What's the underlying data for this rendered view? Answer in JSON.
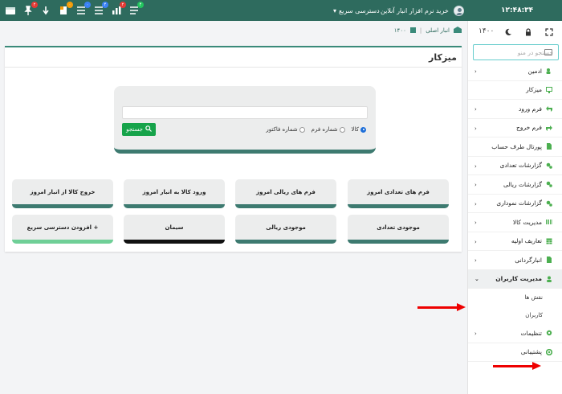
{
  "topbar": {
    "clock": "۱۲:۴۸:۳۴",
    "buy_link": "خرید نرم افزار انبار آنلاین",
    "quick_access": "دسترسی سریع",
    "quick_access_caret": "▾",
    "toolbar_icons": [
      {
        "name": "box-icon",
        "badge": "",
        "badge_color": ""
      },
      {
        "name": "pin-icon",
        "badge": "۲",
        "badge_color": "#e53935"
      },
      {
        "name": "arrow-down-icon",
        "badge": "",
        "badge_color": ""
      },
      {
        "name": "document-icon",
        "badge": "۰",
        "badge_color": "#f59e0b"
      },
      {
        "name": "list-icon",
        "badge": "۰",
        "badge_color": "#3b82f6"
      },
      {
        "name": "list-icon",
        "badge": "۴",
        "badge_color": "#3b82f6"
      },
      {
        "name": "chart-icon",
        "badge": "۲",
        "badge_color": "#e53935"
      },
      {
        "name": "list-icon",
        "badge": "۴",
        "badge_color": "#22c55e"
      }
    ]
  },
  "sidebar": {
    "year": "۱۴۰۰",
    "search_placeholder": "جستجو در منو",
    "items": [
      {
        "label": "ادمین",
        "icon": "users-gear-icon",
        "chevron": true
      },
      {
        "label": "میزکار",
        "icon": "monitor-icon",
        "chevron": false
      },
      {
        "label": "فرم ورود",
        "icon": "reply-icon",
        "chevron": true
      },
      {
        "label": "فرم خروج",
        "icon": "share-icon",
        "chevron": true
      },
      {
        "label": "پورتال طرف حساب",
        "icon": "file-icon",
        "chevron": false
      },
      {
        "label": "گزارشات تعدادی",
        "icon": "cogs-icon",
        "chevron": true
      },
      {
        "label": "گزارشات ریالی",
        "icon": "cogs-icon",
        "chevron": true
      },
      {
        "label": "گزارشات نموداری",
        "icon": "cogs-icon",
        "chevron": true
      },
      {
        "label": "مدیریت کالا",
        "icon": "barcode-icon",
        "chevron": true
      },
      {
        "label": "تعاریف اولیه",
        "icon": "table-icon",
        "chevron": true
      },
      {
        "label": "انبارگردانی",
        "icon": "file-icon",
        "chevron": true
      }
    ],
    "active_item": {
      "label": "مدیریت کاربران",
      "icon": "user-icon"
    },
    "sub_items": [
      "نقش ها",
      "کاربران"
    ],
    "bottom_items": [
      {
        "label": "تنظیمات",
        "icon": "gear-icon",
        "chevron": true
      },
      {
        "label": "پشتیبانی",
        "icon": "support-icon",
        "chevron": false
      }
    ]
  },
  "breadcrumb": {
    "warehouse": "انبار اصلی",
    "year": "۱۴۰۰"
  },
  "main": {
    "title": "میزکار",
    "search": {
      "button": "جستجو",
      "radios": [
        {
          "label": "کالا",
          "checked": true
        },
        {
          "label": "شماره فرم",
          "checked": false
        },
        {
          "label": "شماره فاکتور",
          "checked": false
        }
      ]
    },
    "quick_buttons": [
      "فرم های تعدادی امروز",
      "فرم های ریالی امروز",
      "ورود کالا به انبار امروز",
      "خروج کالا از انبار امروز",
      "موجودی تعدادی",
      "موجودی ریالی",
      "سیمان",
      "+ افزودن دسترسی سریع"
    ]
  },
  "colors": {
    "brand": "#2e6b5e",
    "accent": "#3a8a7a",
    "search_button": "#16a34a",
    "annotation_arrow": "#e00000"
  }
}
